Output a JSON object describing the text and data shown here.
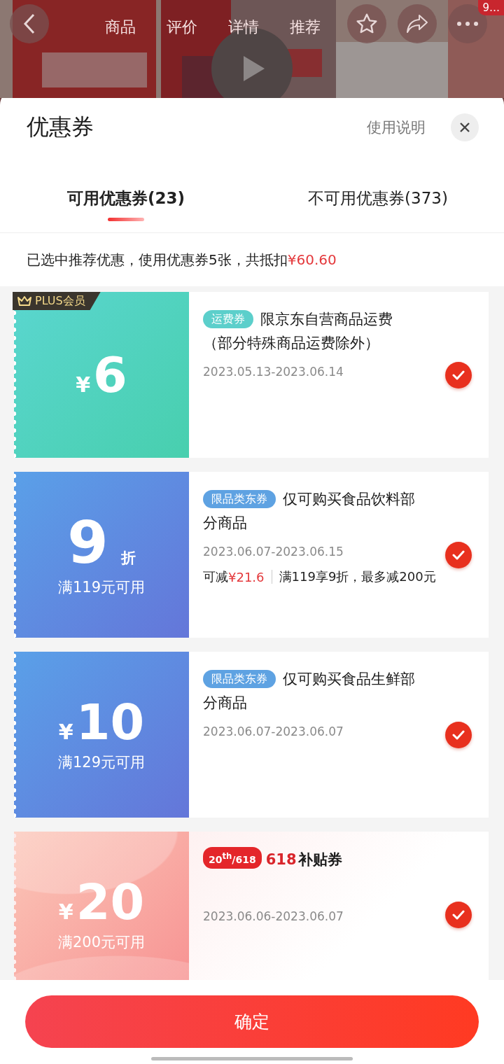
{
  "background": {
    "nav_tabs": [
      "商品",
      "评价",
      "详情",
      "推荐"
    ],
    "badge": "9…"
  },
  "sheet": {
    "title": "优惠券",
    "help_link": "使用说明",
    "tabs": [
      {
        "label": "可用优惠券(23)",
        "selected": true
      },
      {
        "label": "不可用优惠券(373)",
        "selected": false
      }
    ],
    "summary": {
      "text": "已选中推荐优惠，使用优惠券5张，共抵扣",
      "amount": "¥60.60"
    },
    "coupons": [
      {
        "kind": "shipping",
        "badge": "PLUS会员",
        "currency": "¥",
        "value": "6",
        "tag": "运费券",
        "title_lines": [
          "限京东自营商品运费",
          "（部分特殊商品运费除外）"
        ],
        "date": "2023.05.13-2023.06.14",
        "checked": true
      },
      {
        "kind": "category",
        "value": "9",
        "unit": "折",
        "condition": "满119元可用",
        "tag": "限品类东券",
        "title_lines": [
          "仅可购买食品饮料部",
          "分商品"
        ],
        "date": "2023.06.07-2023.06.15",
        "savings": {
          "label": "可减",
          "amount": "¥21.6",
          "rule": "满119享9折，最多减200元"
        },
        "checked": true
      },
      {
        "kind": "category",
        "currency": "¥",
        "value": "10",
        "condition": "满129元可用",
        "tag": "限品类东券",
        "title_lines": [
          "仅可购买食品生鲜部",
          "分商品"
        ],
        "date": "2023.06.07-2023.06.07",
        "checked": true
      },
      {
        "kind": "promo",
        "currency": "¥",
        "value": "20",
        "condition": "满200元可用",
        "tag": "20$^{th}$/618",
        "title_highlight": "618",
        "title_lines": [
          "补贴券"
        ],
        "date": "2023.06.06-2023.06.07",
        "checked": true
      }
    ],
    "confirm_button": "确定"
  }
}
